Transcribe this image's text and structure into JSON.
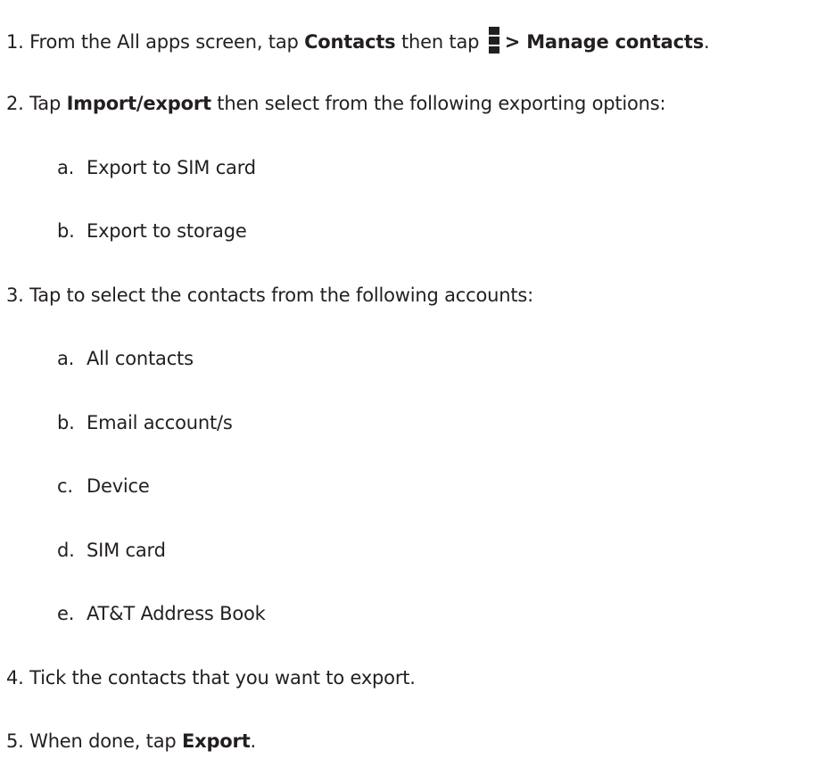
{
  "steps": [
    {
      "number": "1.",
      "text_a": "From the All apps screen, tap ",
      "bold_a": "Contacts",
      "text_b": " then tap ",
      "icon": "overflow-menu-icon",
      "bold_b": "> Manage contacts",
      "text_c": "."
    },
    {
      "number": "2.",
      "text_a": "Tap ",
      "bold_a": "Import/export",
      "text_b": " then select from the following exporting options:",
      "options": [
        {
          "letter": "a.",
          "label": "Export to SIM card"
        },
        {
          "letter": "b.",
          "label": "Export to storage"
        }
      ]
    },
    {
      "number": "3.",
      "text_a": "Tap to select the contacts from the following accounts:",
      "options": [
        {
          "letter": "a.",
          "label": "All contacts"
        },
        {
          "letter": "b.",
          "label": "Email account/s"
        },
        {
          "letter": "c.",
          "label": "Device"
        },
        {
          "letter": "d.",
          "label": "SIM card"
        },
        {
          "letter": "e.",
          "label": "AT&T Address Book"
        }
      ]
    },
    {
      "number": "4.",
      "text_a": "Tick the contacts that you want to export."
    },
    {
      "number": "5.",
      "text_a": "When done, tap ",
      "bold_a": "Export",
      "text_b": "."
    }
  ]
}
